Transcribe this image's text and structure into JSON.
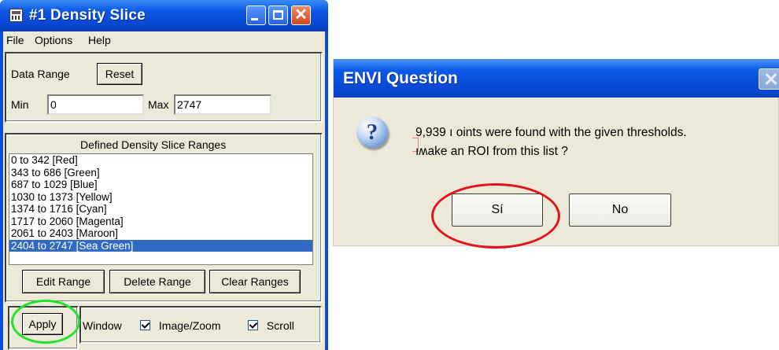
{
  "density_window": {
    "title": "#1 Density Slice",
    "menu": [
      "File",
      "Options",
      "Help"
    ],
    "data_range_label": "Data Range",
    "reset_label": "Reset",
    "min_label": "Min",
    "min_value": "0",
    "max_label": "Max",
    "max_value": "2747",
    "ranges_title": "Defined Density Slice Ranges",
    "ranges": [
      "0 to 342 [Red]",
      "343 to 686 [Green]",
      "687 to 1029 [Blue]",
      "1030 to 1373 [Yellow]",
      "1374 to 1716 [Cyan]",
      "1717 to 2060 [Magenta]",
      "2061 to 2403 [Maroon]",
      "2404 to 2747 [Sea Green]"
    ],
    "selected_range": "2404 to 2747 [Sea Green]",
    "edit_range_label": "Edit Range",
    "delete_range_label": "Delete Range",
    "clear_ranges_label": "Clear Ranges",
    "apply_label": "Apply",
    "window_label": "Window",
    "image_zoom_label": "Image/Zoom",
    "scroll_label": "Scroll",
    "image_zoom_checked": true,
    "scroll_checked": true
  },
  "question_dialog": {
    "title": "ENVI Question",
    "message_line1": "9,939 ı oints were found with the given thresholds.",
    "message_line2": "ıʍake an ROI from this list ?",
    "yes_label": "Sí",
    "no_label": "No"
  },
  "annotations": {
    "green_circle_color": "#22e22a",
    "red_circle_color": "#e0141c"
  }
}
